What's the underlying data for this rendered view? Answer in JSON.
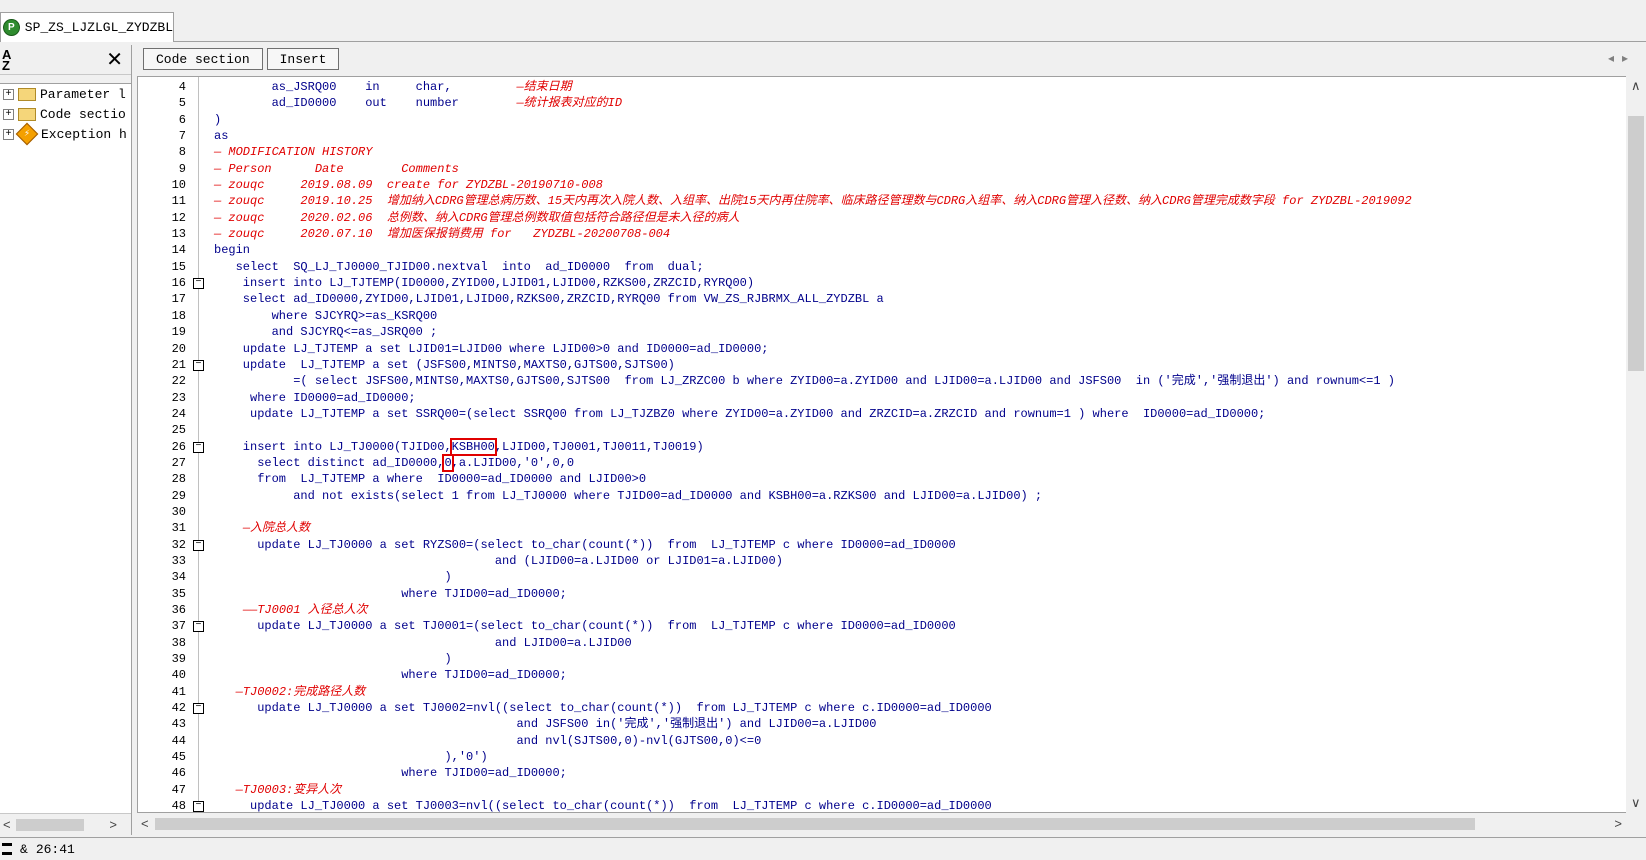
{
  "tab": {
    "title": "SP_ZS_LJZLGL_ZYDZBL"
  },
  "left_panel": {
    "sort_label": "A↓Z",
    "items": [
      {
        "label": "Parameter l"
      },
      {
        "label": "Code sectio"
      },
      {
        "label": "Exception h"
      }
    ]
  },
  "toolbar": {
    "code_section": "Code section",
    "insert": "Insert"
  },
  "code": [
    {
      "n": "4",
      "fold": false,
      "segs": [
        {
          "t": "        as_JSRQ00    in     char,         "
        },
        {
          "t": "—结束日期",
          "c": 1
        }
      ]
    },
    {
      "n": "5",
      "fold": false,
      "segs": [
        {
          "t": "        ad_ID0000    out    number        "
        },
        {
          "t": "—统计报表对应的ID",
          "c": 1
        }
      ]
    },
    {
      "n": "6",
      "fold": false,
      "segs": [
        {
          "t": ")"
        }
      ]
    },
    {
      "n": "7",
      "fold": false,
      "segs": [
        {
          "t": "as"
        }
      ]
    },
    {
      "n": "8",
      "fold": false,
      "segs": [
        {
          "t": "— MODIFICATION HISTORY",
          "c": 1
        }
      ]
    },
    {
      "n": "9",
      "fold": false,
      "segs": [
        {
          "t": "— Person      Date        Comments",
          "c": 1
        }
      ]
    },
    {
      "n": "10",
      "fold": false,
      "segs": [
        {
          "t": "— zouqc     2019.08.09  create for ZYDZBL-20190710-008",
          "c": 1
        }
      ]
    },
    {
      "n": "11",
      "fold": false,
      "segs": [
        {
          "t": "— zouqc     2019.10.25  增加纳入CDRG管理总病历数、15天内再次入院人数、入组率、出院15天内再住院率、临床路径管理数与CDRG入组率、纳入CDRG管理入径数、纳入CDRG管理完成数字段 for ZYDZBL-2019092",
          "c": 1
        }
      ]
    },
    {
      "n": "12",
      "fold": false,
      "segs": [
        {
          "t": "— zouqc     2020.02.06  总例数、纳入CDRG管理总例数取值包括符合路径但是未入径的病人",
          "c": 1
        }
      ]
    },
    {
      "n": "13",
      "fold": false,
      "segs": [
        {
          "t": "— zouqc     2020.07.10  增加医保报销费用 for   ZYDZBL-20200708-004",
          "c": 1
        }
      ]
    },
    {
      "n": "14",
      "fold": false,
      "segs": [
        {
          "t": "begin"
        }
      ]
    },
    {
      "n": "15",
      "fold": false,
      "segs": [
        {
          "t": "   select  SQ_LJ_TJ0000_TJID00.nextval  into  ad_ID0000  from  dual;"
        }
      ]
    },
    {
      "n": "16",
      "fold": true,
      "segs": [
        {
          "t": "    insert into LJ_TJTEMP(ID0000,ZYID00,LJID01,LJID00,RZKS00,ZRZCID,RYRQ00)"
        }
      ]
    },
    {
      "n": "17",
      "fold": false,
      "segs": [
        {
          "t": "    select ad_ID0000,ZYID00,LJID01,LJID00,RZKS00,ZRZCID,RYRQ00 from VW_ZS_RJBRMX_ALL_ZYDZBL a"
        }
      ]
    },
    {
      "n": "18",
      "fold": false,
      "segs": [
        {
          "t": "        where SJCYRQ>=as_KSRQ00"
        }
      ]
    },
    {
      "n": "19",
      "fold": false,
      "segs": [
        {
          "t": "        and SJCYRQ<=as_JSRQ00 ;"
        }
      ]
    },
    {
      "n": "20",
      "fold": false,
      "segs": [
        {
          "t": "    update LJ_TJTEMP a set LJID01=LJID00 where LJID00>0 and ID0000=ad_ID0000;"
        }
      ]
    },
    {
      "n": "21",
      "fold": true,
      "segs": [
        {
          "t": "    update  LJ_TJTEMP a set (JSFS00,MINTS0,MAXTS0,GJTS00,SJTS00)"
        }
      ]
    },
    {
      "n": "22",
      "fold": false,
      "segs": [
        {
          "t": "           =( select JSFS00,MINTS0,MAXTS0,GJTS00,SJTS00  from LJ_ZRZC00 b where ZYID00=a.ZYID00 and LJID00=a.LJID00 and JSFS00  in ('完成','强制退出') and rownum<=1 )"
        }
      ]
    },
    {
      "n": "23",
      "fold": false,
      "segs": [
        {
          "t": "     where ID0000=ad_ID0000;"
        }
      ]
    },
    {
      "n": "24",
      "fold": false,
      "segs": [
        {
          "t": "     update LJ_TJTEMP a set SSRQ00=(select SSRQ00 from LJ_TJZBZ0 where ZYID00=a.ZYID00 and ZRZCID=a.ZRZCID and rownum=1 ) where  ID0000=ad_ID0000;"
        }
      ]
    },
    {
      "n": "25",
      "fold": false,
      "segs": [
        {
          "t": ""
        }
      ]
    },
    {
      "n": "26",
      "fold": true,
      "segs": [
        {
          "t": "    insert into LJ_TJ0000(TJID00,"
        },
        {
          "t": "KSBH00",
          "b": 1
        },
        {
          "t": ",LJID00,TJ0001,TJ0011,TJ0019)"
        }
      ]
    },
    {
      "n": "27",
      "fold": false,
      "segs": [
        {
          "t": "      select distinct ad_ID0000,"
        },
        {
          "t": "0",
          "b": 1
        },
        {
          "t": ",a.LJID00,'0',0,0"
        }
      ]
    },
    {
      "n": "28",
      "fold": false,
      "segs": [
        {
          "t": "      from  LJ_TJTEMP a where  ID0000=ad_ID0000 and LJID00>0"
        }
      ]
    },
    {
      "n": "29",
      "fold": false,
      "segs": [
        {
          "t": "           and not exists(select 1 from LJ_TJ0000 where TJID00=ad_ID0000 and KSBH00=a.RZKS00 and LJID00=a.LJID00) ;"
        }
      ]
    },
    {
      "n": "30",
      "fold": false,
      "segs": [
        {
          "t": ""
        }
      ]
    },
    {
      "n": "31",
      "fold": false,
      "segs": [
        {
          "t": "    "
        },
        {
          "t": "—入院总人数",
          "c": 1
        }
      ]
    },
    {
      "n": "32",
      "fold": true,
      "segs": [
        {
          "t": "      update LJ_TJ0000 a set RYZS00=(select to_char(count(*))  from  LJ_TJTEMP c where ID0000=ad_ID0000"
        }
      ]
    },
    {
      "n": "33",
      "fold": false,
      "segs": [
        {
          "t": "                                       and (LJID00=a.LJID00 or LJID01=a.LJID00)"
        }
      ]
    },
    {
      "n": "34",
      "fold": false,
      "segs": [
        {
          "t": "                                )"
        }
      ]
    },
    {
      "n": "35",
      "fold": false,
      "segs": [
        {
          "t": "                          where TJID00=ad_ID0000;"
        }
      ]
    },
    {
      "n": "36",
      "fold": false,
      "segs": [
        {
          "t": "    "
        },
        {
          "t": "——TJ0001 入径总人次",
          "c": 1
        }
      ]
    },
    {
      "n": "37",
      "fold": true,
      "segs": [
        {
          "t": "      update LJ_TJ0000 a set TJ0001=(select to_char(count(*))  from  LJ_TJTEMP c where ID0000=ad_ID0000"
        }
      ]
    },
    {
      "n": "38",
      "fold": false,
      "segs": [
        {
          "t": "                                       and LJID00=a.LJID00"
        }
      ]
    },
    {
      "n": "39",
      "fold": false,
      "segs": [
        {
          "t": "                                )"
        }
      ]
    },
    {
      "n": "40",
      "fold": false,
      "segs": [
        {
          "t": "                          where TJID00=ad_ID0000;"
        }
      ]
    },
    {
      "n": "41",
      "fold": false,
      "segs": [
        {
          "t": "   "
        },
        {
          "t": "—TJ0002:完成路径人数",
          "c": 1
        }
      ]
    },
    {
      "n": "42",
      "fold": true,
      "segs": [
        {
          "t": "      update LJ_TJ0000 a set TJ0002=nvl((select to_char(count(*))  from LJ_TJTEMP c where c.ID0000=ad_ID0000"
        }
      ]
    },
    {
      "n": "43",
      "fold": false,
      "segs": [
        {
          "t": "                                          and JSFS00 in('完成','强制退出') and LJID00=a.LJID00"
        }
      ]
    },
    {
      "n": "44",
      "fold": false,
      "segs": [
        {
          "t": "                                          and nvl(SJTS00,0)-nvl(GJTS00,0)<=0"
        }
      ]
    },
    {
      "n": "45",
      "fold": false,
      "segs": [
        {
          "t": "                                ),'0')"
        }
      ]
    },
    {
      "n": "46",
      "fold": false,
      "segs": [
        {
          "t": "                          where TJID00=ad_ID0000;"
        }
      ]
    },
    {
      "n": "47",
      "fold": false,
      "segs": [
        {
          "t": "   "
        },
        {
          "t": "—TJ0003:变异人次",
          "c": 1
        }
      ]
    },
    {
      "n": "48",
      "fold": true,
      "segs": [
        {
          "t": "     update LJ_TJ0000 a set TJ0003=nvl((select to_char(count(*))  from  LJ_TJTEMP c where c.ID0000=ad_ID0000"
        }
      ]
    }
  ],
  "status": {
    "amp": "&",
    "position": "26:41"
  }
}
